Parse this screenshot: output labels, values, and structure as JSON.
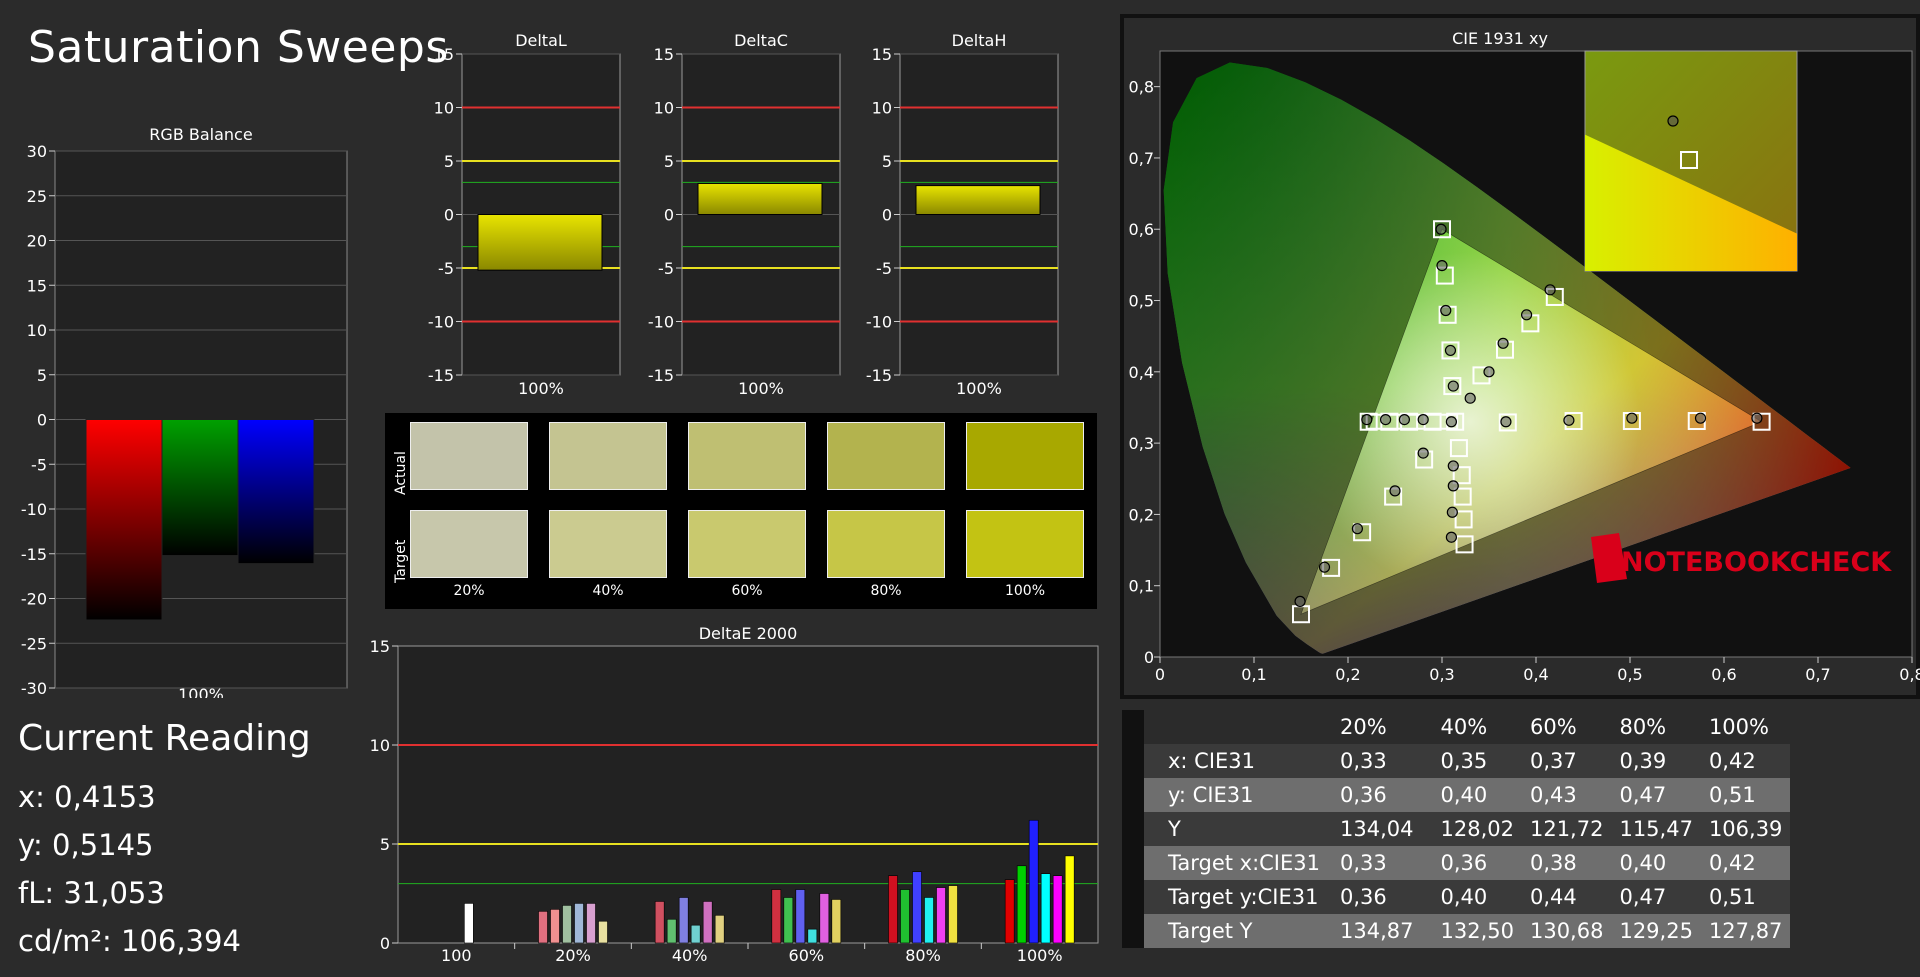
{
  "page_title": "Saturation Sweeps",
  "current_reading": {
    "title": "Current Reading",
    "x": "x: 0,4153",
    "y": "y: 0,5145",
    "fl": "fL: 31,053",
    "cdm2": "cd/m²: 106,394"
  },
  "colors": {
    "background": "#2b2b2b",
    "plot_bg": "#222222",
    "red_limit": "#e03030",
    "yellow_limit": "#e8e020",
    "green_limit": "#20b020",
    "sample_color": "#c8c400"
  },
  "swatches": {
    "row_labels": [
      "Actual",
      "Target"
    ],
    "steps": [
      "20%",
      "40%",
      "60%",
      "80%",
      "100%"
    ],
    "actual_colors": [
      "#c3c3aa",
      "#c4c491",
      "#bfbf72",
      "#b3b34e",
      "#a8a800"
    ],
    "target_colors": [
      "#c7c7ab",
      "#cbcb90",
      "#c9c96e",
      "#c6c647",
      "#c3c313"
    ]
  },
  "chart_data": [
    {
      "type": "bar",
      "title": "RGB Balance",
      "categories": [
        "100%"
      ],
      "series": [
        {
          "color": "#ff0000",
          "values": [
            -22.4
          ]
        },
        {
          "color": "#00a000",
          "values": [
            -15.2
          ]
        },
        {
          "color": "#0000ff",
          "values": [
            -16.1
          ]
        }
      ],
      "ylim": [
        -30,
        30
      ],
      "yticks": [
        30,
        25,
        20,
        15,
        10,
        5,
        0,
        -5,
        -10,
        -15,
        -20,
        -25,
        -30
      ],
      "grid": true
    },
    {
      "type": "bar",
      "title": "DeltaL",
      "categories": [
        "100%"
      ],
      "values": [
        -5.2
      ],
      "ylim": [
        -15,
        15
      ],
      "yticks": [
        15,
        10,
        5,
        0,
        -5,
        -10,
        -15
      ],
      "limits": {
        "red": [
          10,
          -10
        ],
        "yellow": [
          5,
          -5
        ],
        "green": [
          3,
          -3
        ]
      }
    },
    {
      "type": "bar",
      "title": "DeltaC",
      "categories": [
        "100%"
      ],
      "values": [
        2.9
      ],
      "ylim": [
        -15,
        15
      ],
      "yticks": [
        15,
        10,
        5,
        0,
        -5,
        -10,
        -15
      ],
      "limits": {
        "red": [
          10,
          -10
        ],
        "yellow": [
          5,
          -5
        ],
        "green": [
          3,
          -3
        ]
      }
    },
    {
      "type": "bar",
      "title": "DeltaH",
      "categories": [
        "100%"
      ],
      "values": [
        2.7
      ],
      "ylim": [
        -15,
        15
      ],
      "yticks": [
        15,
        10,
        5,
        0,
        -5,
        -10,
        -15
      ],
      "limits": {
        "red": [
          10,
          -10
        ],
        "yellow": [
          5,
          -5
        ],
        "green": [
          3,
          -3
        ]
      }
    },
    {
      "type": "bar",
      "title": "DeltaE 2000",
      "categories": [
        "100",
        "20%",
        "40%",
        "60%",
        "80%",
        "100%"
      ],
      "groups": [
        {
          "bars": [
            {
              "color": "#ffffff",
              "value": 2.0
            }
          ]
        },
        {
          "bars": [
            {
              "color": "#e07080",
              "value": 1.6
            },
            {
              "color": "#f09090",
              "value": 1.7
            },
            {
              "color": "#a0c0a0",
              "value": 1.9
            },
            {
              "color": "#a0b8d8",
              "value": 2.0
            },
            {
              "color": "#d8a0d0",
              "value": 2.0
            },
            {
              "color": "#e8e0a0",
              "value": 1.1
            }
          ]
        },
        {
          "bars": [
            {
              "color": "#d05060",
              "value": 2.1
            },
            {
              "color": "#60c070",
              "value": 1.2
            },
            {
              "color": "#8080e0",
              "value": 2.3
            },
            {
              "color": "#70d0d0",
              "value": 0.9
            },
            {
              "color": "#d070c0",
              "value": 2.1
            },
            {
              "color": "#e0d080",
              "value": 1.4
            }
          ]
        },
        {
          "bars": [
            {
              "color": "#d03040",
              "value": 2.7
            },
            {
              "color": "#40c050",
              "value": 2.3
            },
            {
              "color": "#6060f0",
              "value": 2.7
            },
            {
              "color": "#40e0e0",
              "value": 0.7
            },
            {
              "color": "#e060e0",
              "value": 2.5
            },
            {
              "color": "#e0d060",
              "value": 2.2
            }
          ]
        },
        {
          "bars": [
            {
              "color": "#d01020",
              "value": 3.4
            },
            {
              "color": "#20c030",
              "value": 2.7
            },
            {
              "color": "#4040ff",
              "value": 3.6
            },
            {
              "color": "#20f0f0",
              "value": 2.3
            },
            {
              "color": "#f040f0",
              "value": 2.8
            },
            {
              "color": "#f0e040",
              "value": 2.9
            }
          ]
        },
        {
          "bars": [
            {
              "color": "#e00000",
              "value": 3.2
            },
            {
              "color": "#00d000",
              "value": 3.9
            },
            {
              "color": "#2020ff",
              "value": 6.2
            },
            {
              "color": "#00ffff",
              "value": 3.5
            },
            {
              "color": "#ff00ff",
              "value": 3.4
            },
            {
              "color": "#ffff00",
              "value": 4.4
            }
          ]
        }
      ],
      "ylim": [
        0,
        15
      ],
      "yticks": [
        15,
        10,
        5,
        0
      ],
      "limits": {
        "red": 10,
        "yellow": 5,
        "green": 3
      }
    },
    {
      "type": "scatter",
      "title": "CIE 1931 xy",
      "xlim": [
        0,
        0.8
      ],
      "ylim": [
        0,
        0.85
      ],
      "xticks": [
        "0",
        "0,1",
        "0,2",
        "0,3",
        "0,4",
        "0,5",
        "0,6",
        "0,7",
        "0,8"
      ],
      "yticks": [
        "0",
        "0,1",
        "0,2",
        "0,3",
        "0,4",
        "0,5",
        "0,6",
        "0,7",
        "0,8"
      ],
      "xtick_values": [
        0,
        0.1,
        0.2,
        0.3,
        0.4,
        0.5,
        0.6,
        0.7,
        0.8
      ],
      "ytick_values": [
        0,
        0.1,
        0.2,
        0.3,
        0.4,
        0.5,
        0.6,
        0.7,
        0.8
      ],
      "gamut_triangle": [
        [
          0.64,
          0.33
        ],
        [
          0.3,
          0.6
        ],
        [
          0.15,
          0.06
        ]
      ],
      "white_point": [
        0.3127,
        0.329
      ],
      "targets": [
        [
          0.64,
          0.33
        ],
        [
          0.571,
          0.331
        ],
        [
          0.502,
          0.331
        ],
        [
          0.44,
          0.331
        ],
        [
          0.37,
          0.329
        ],
        [
          0.3,
          0.6
        ],
        [
          0.303,
          0.535
        ],
        [
          0.306,
          0.48
        ],
        [
          0.309,
          0.43
        ],
        [
          0.311,
          0.38
        ],
        [
          0.15,
          0.06
        ],
        [
          0.182,
          0.125
        ],
        [
          0.215,
          0.175
        ],
        [
          0.248,
          0.225
        ],
        [
          0.281,
          0.277
        ],
        [
          0.222,
          0.33
        ],
        [
          0.244,
          0.33
        ],
        [
          0.265,
          0.33
        ],
        [
          0.29,
          0.33
        ],
        [
          0.318,
          0.293
        ],
        [
          0.321,
          0.255
        ],
        [
          0.322,
          0.225
        ],
        [
          0.323,
          0.193
        ],
        [
          0.324,
          0.158
        ],
        [
          0.42,
          0.505
        ],
        [
          0.394,
          0.468
        ],
        [
          0.367,
          0.431
        ],
        [
          0.342,
          0.395
        ],
        [
          0.314,
          0.33
        ]
      ],
      "measured": [
        [
          0.635,
          0.335
        ],
        [
          0.575,
          0.335
        ],
        [
          0.502,
          0.335
        ],
        [
          0.435,
          0.332
        ],
        [
          0.368,
          0.33
        ],
        [
          0.299,
          0.6
        ],
        [
          0.3,
          0.549
        ],
        [
          0.304,
          0.486
        ],
        [
          0.309,
          0.43
        ],
        [
          0.312,
          0.38
        ],
        [
          0.149,
          0.078
        ],
        [
          0.175,
          0.126
        ],
        [
          0.21,
          0.18
        ],
        [
          0.25,
          0.233
        ],
        [
          0.28,
          0.286
        ],
        [
          0.22,
          0.333
        ],
        [
          0.24,
          0.333
        ],
        [
          0.26,
          0.333
        ],
        [
          0.28,
          0.333
        ],
        [
          0.312,
          0.268
        ],
        [
          0.312,
          0.24
        ],
        [
          0.311,
          0.203
        ],
        [
          0.31,
          0.168
        ],
        [
          0.31,
          0.33
        ],
        [
          0.415,
          0.515
        ],
        [
          0.39,
          0.48
        ],
        [
          0.365,
          0.44
        ],
        [
          0.35,
          0.4
        ],
        [
          0.33,
          0.363
        ]
      ],
      "inset_measured": [
        0.4153,
        0.5145
      ],
      "inset_target": [
        0.42,
        0.505
      ],
      "watermark": "NOTEBOOKCHECK"
    }
  ],
  "cie_table": {
    "headers": [
      "",
      "20%",
      "40%",
      "60%",
      "80%",
      "100%"
    ],
    "rows": [
      [
        "x: CIE31",
        "0,33",
        "0,35",
        "0,37",
        "0,39",
        "0,42"
      ],
      [
        "y: CIE31",
        "0,36",
        "0,40",
        "0,43",
        "0,47",
        "0,51"
      ],
      [
        "Y",
        "134,04",
        "128,02",
        "121,72",
        "115,47",
        "106,39"
      ],
      [
        "Target x:CIE31",
        "0,33",
        "0,36",
        "0,38",
        "0,40",
        "0,42"
      ],
      [
        "Target y:CIE31",
        "0,36",
        "0,40",
        "0,44",
        "0,47",
        "0,51"
      ],
      [
        "Target Y",
        "134,87",
        "132,50",
        "130,68",
        "129,25",
        "127,87"
      ]
    ]
  }
}
